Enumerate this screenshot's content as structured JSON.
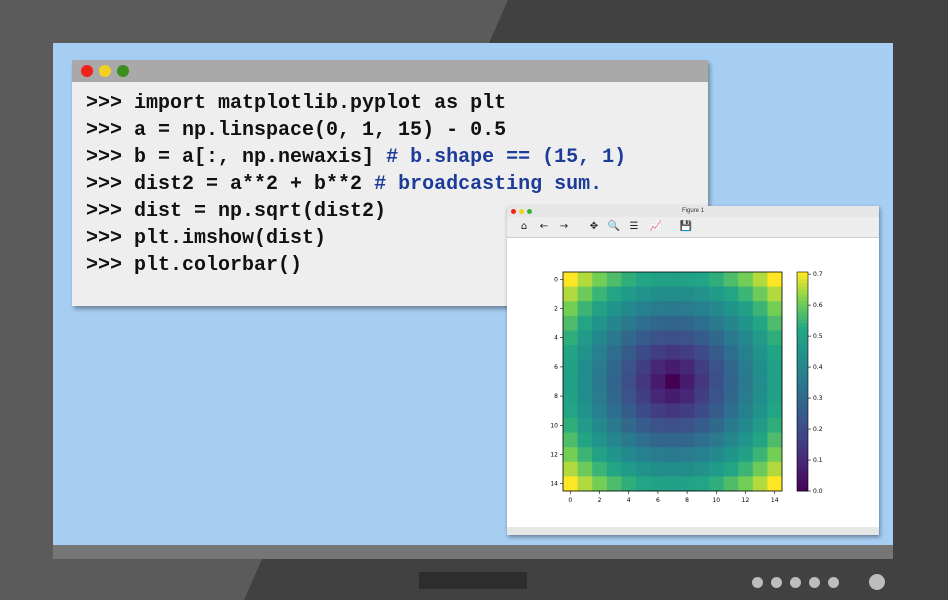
{
  "terminal": {
    "lines": [
      {
        "prompt": ">>> ",
        "code": "import matplotlib.pyplot as plt",
        "comment": ""
      },
      {
        "prompt": ">>> ",
        "code": "a = np.linspace(0, 1, 15) - 0.5",
        "comment": ""
      },
      {
        "prompt": ">>> ",
        "code": "b = a[:, np.newaxis] ",
        "comment": "# b.shape == (15, 1)"
      },
      {
        "prompt": ">>> ",
        "code": "dist2 = a**2 + b**2 ",
        "comment": "# broadcasting sum."
      },
      {
        "prompt": ">>> ",
        "code": "dist = np.sqrt(dist2)",
        "comment": ""
      },
      {
        "prompt": ">>> ",
        "code": "plt.imshow(dist)",
        "comment": ""
      },
      {
        "prompt": ">>> ",
        "code": "plt.colorbar()",
        "comment": ""
      }
    ]
  },
  "figure": {
    "title": "Figure 1",
    "toolbar": [
      {
        "name": "home-icon",
        "glyph": "⌂"
      },
      {
        "name": "back-icon",
        "glyph": "←"
      },
      {
        "name": "forward-icon",
        "glyph": "→"
      },
      {
        "name": "pan-icon",
        "glyph": "✥"
      },
      {
        "name": "zoom-icon",
        "glyph": "🔍"
      },
      {
        "name": "configure-icon",
        "glyph": "☰"
      },
      {
        "name": "edit-axis-icon",
        "glyph": "📈"
      },
      {
        "name": "save-icon",
        "glyph": "💾"
      }
    ]
  },
  "chart_data": {
    "type": "heatmap",
    "title": "",
    "xlabel": "",
    "ylabel": "",
    "grid_size": 15,
    "values_formula": "sqrt(a_i^2 + a_j^2), a = linspace(0,1,15) - 0.5",
    "x_ticks": [
      "0",
      "2",
      "4",
      "6",
      "8",
      "10",
      "12",
      "14"
    ],
    "y_ticks": [
      "0",
      "2",
      "4",
      "6",
      "8",
      "10",
      "12",
      "14"
    ],
    "colorbar_ticks": [
      "0.0",
      "0.1",
      "0.2",
      "0.3",
      "0.4",
      "0.5",
      "0.6",
      "0.7"
    ],
    "colorbar_range": [
      0.0,
      0.707
    ],
    "colormap": "viridis"
  }
}
